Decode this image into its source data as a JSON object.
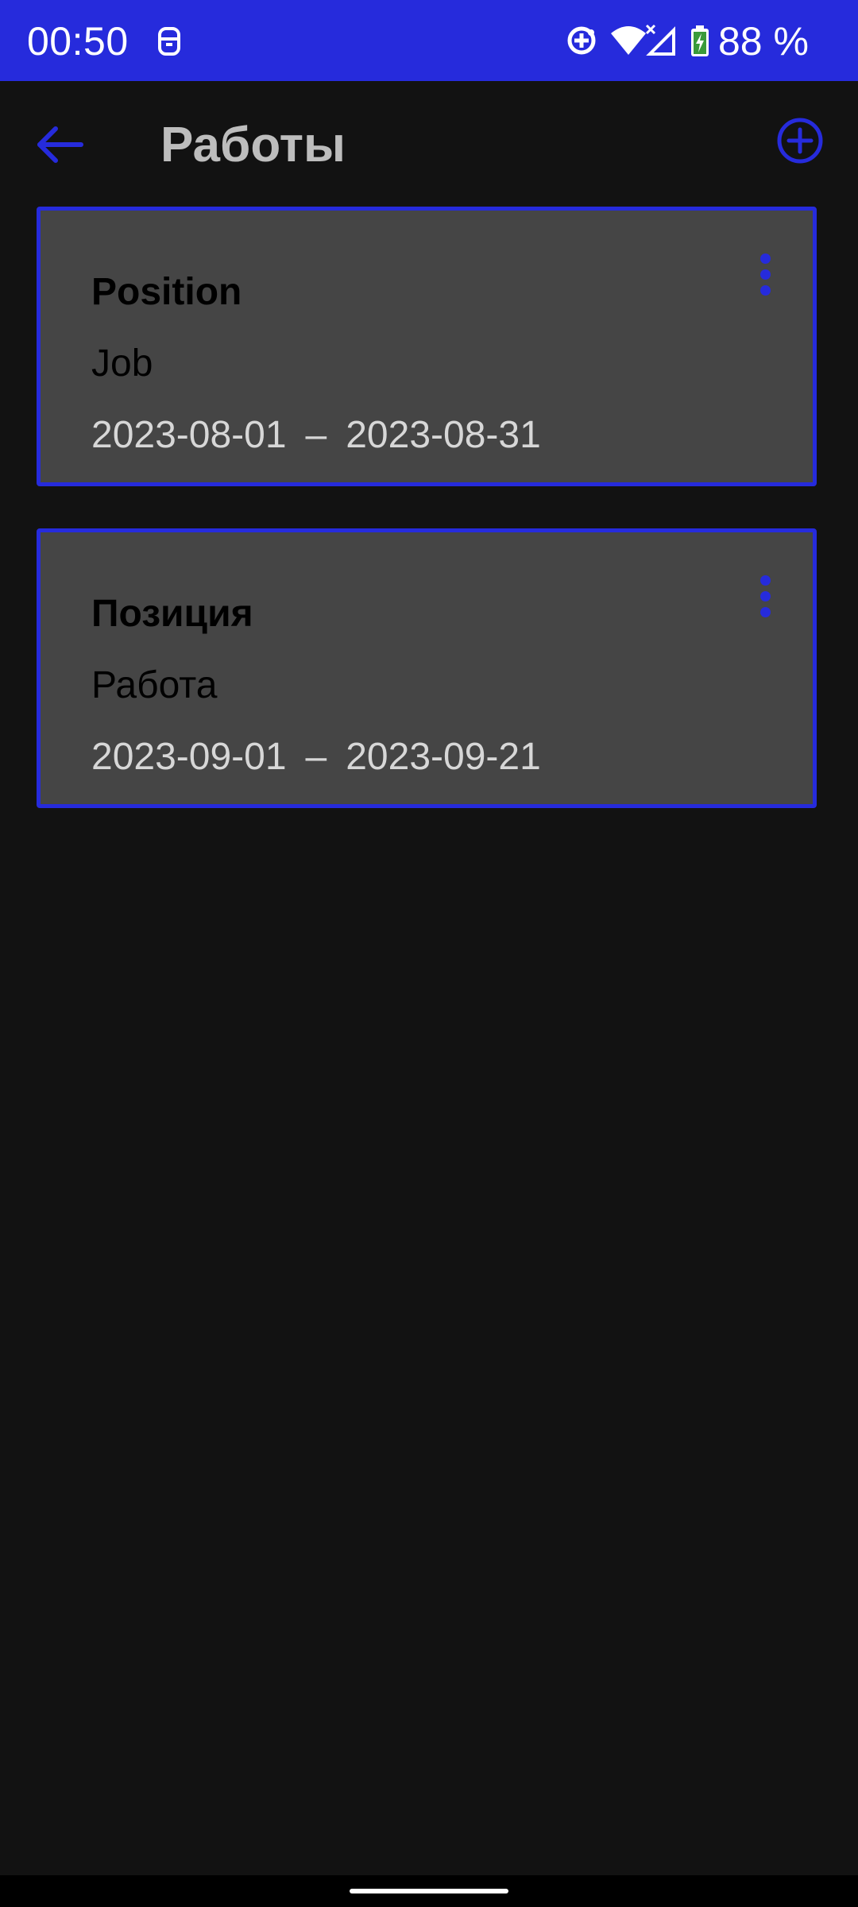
{
  "status_bar": {
    "time": "00:50",
    "battery_text": "88 %",
    "icons": [
      "notification-app-icon",
      "sync-icon",
      "wifi-icon",
      "no-signal-icon",
      "battery-charging-icon"
    ],
    "background_color": "#262bdc"
  },
  "app_bar": {
    "title": "Работы",
    "back_icon": "arrow-left-icon",
    "add_icon": "add-circle-icon",
    "accent_color": "#262bdc"
  },
  "jobs": [
    {
      "position": "Position",
      "company": "Job",
      "start_date": "2023-08-01",
      "separator": "–",
      "end_date": "2023-08-31",
      "menu_icon": "more-vert-icon"
    },
    {
      "position": "Позиция",
      "company": "Работа",
      "start_date": "2023-09-01",
      "separator": "–",
      "end_date": "2023-09-21",
      "menu_icon": "more-vert-icon"
    }
  ],
  "nav_bar": {
    "home_indicator": "home-handle"
  }
}
